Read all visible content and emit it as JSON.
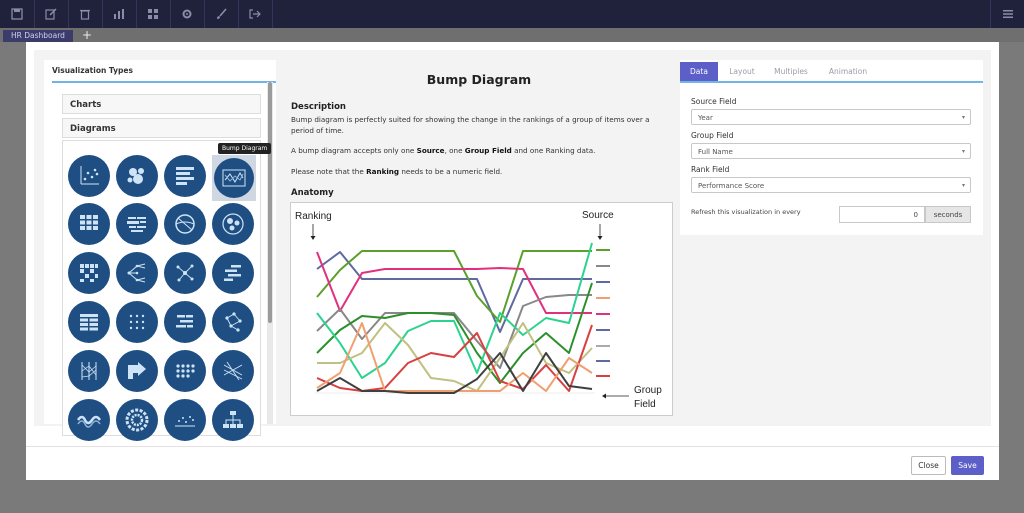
{
  "toolbar": {
    "icons": [
      "save-icon",
      "edit-icon",
      "trash-icon",
      "bar-chart-icon",
      "grid-icon",
      "gear-icon",
      "brush-icon",
      "export-icon"
    ],
    "menu_icon": "hamburger-icon"
  },
  "dashboard_tab": "HR Dashboard",
  "add_tab_label": "+",
  "left_panel": {
    "title": "Visualization Types",
    "sections": [
      "Charts",
      "Diagrams"
    ],
    "tooltip": "Bump Diagram"
  },
  "description": {
    "heading": "Bump Diagram",
    "description_title": "Description",
    "para1": "Bump diagram is perfectly suited for showing the change in the rankings of a group of items over a period of time.",
    "para2_pre": "A bump diagram accepts only one ",
    "para2_b1": "Source",
    "para2_mid1": ", one ",
    "para2_b2": "Group Field",
    "para2_post": " and one Ranking data.",
    "para3_pre": "Please note that the ",
    "para3_b": "Ranking",
    "para3_post": " needs to be a numeric field.",
    "anatomy_title": "Anatomy",
    "anatomy": {
      "ranking_label": "Ranking",
      "source_label": "Source",
      "group_label_1": "Group",
      "group_label_2": "Field"
    }
  },
  "right_panel": {
    "tabs": [
      "Data",
      "Layout",
      "Multiples",
      "Animation"
    ],
    "active_tab": "Data",
    "source_field_label": "Source Field",
    "source_field_value": "Year",
    "group_field_label": "Group Field",
    "group_field_value": "Full Name",
    "rank_field_label": "Rank Field",
    "rank_field_value": "Performance Score",
    "refresh_label": "Refresh this visualization in every",
    "refresh_value": "0",
    "refresh_unit": "seconds"
  },
  "footer": {
    "close_label": "Close",
    "save_label": "Save"
  },
  "colors": {
    "topbar": "#20213a",
    "accent": "#5b5fc7",
    "tile": "#1f4f82"
  }
}
